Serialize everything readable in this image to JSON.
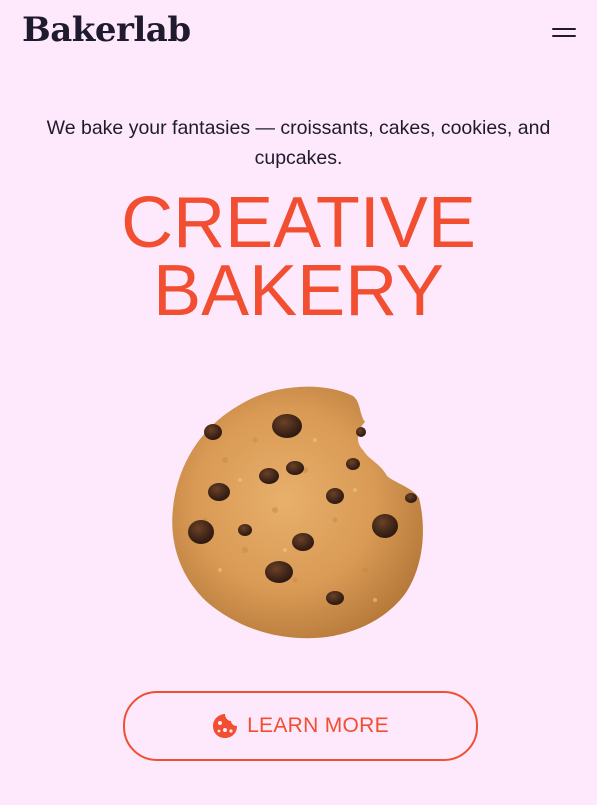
{
  "header": {
    "logo": "Bakerlab",
    "menu_icon": "hamburger-menu-icon"
  },
  "hero": {
    "tagline": "We bake your fantasies — croissants, cakes, cookies, and cupcakes.",
    "headline_line1": "CREATIVE",
    "headline_line2": "BAKERY",
    "image_subject": "chocolate-chip-cookie"
  },
  "cta": {
    "label": "LEARN MORE",
    "icon": "cookie-icon"
  },
  "colors": {
    "background": "#fde9fb",
    "accent": "#f24e32",
    "text": "#1f1a2e"
  }
}
